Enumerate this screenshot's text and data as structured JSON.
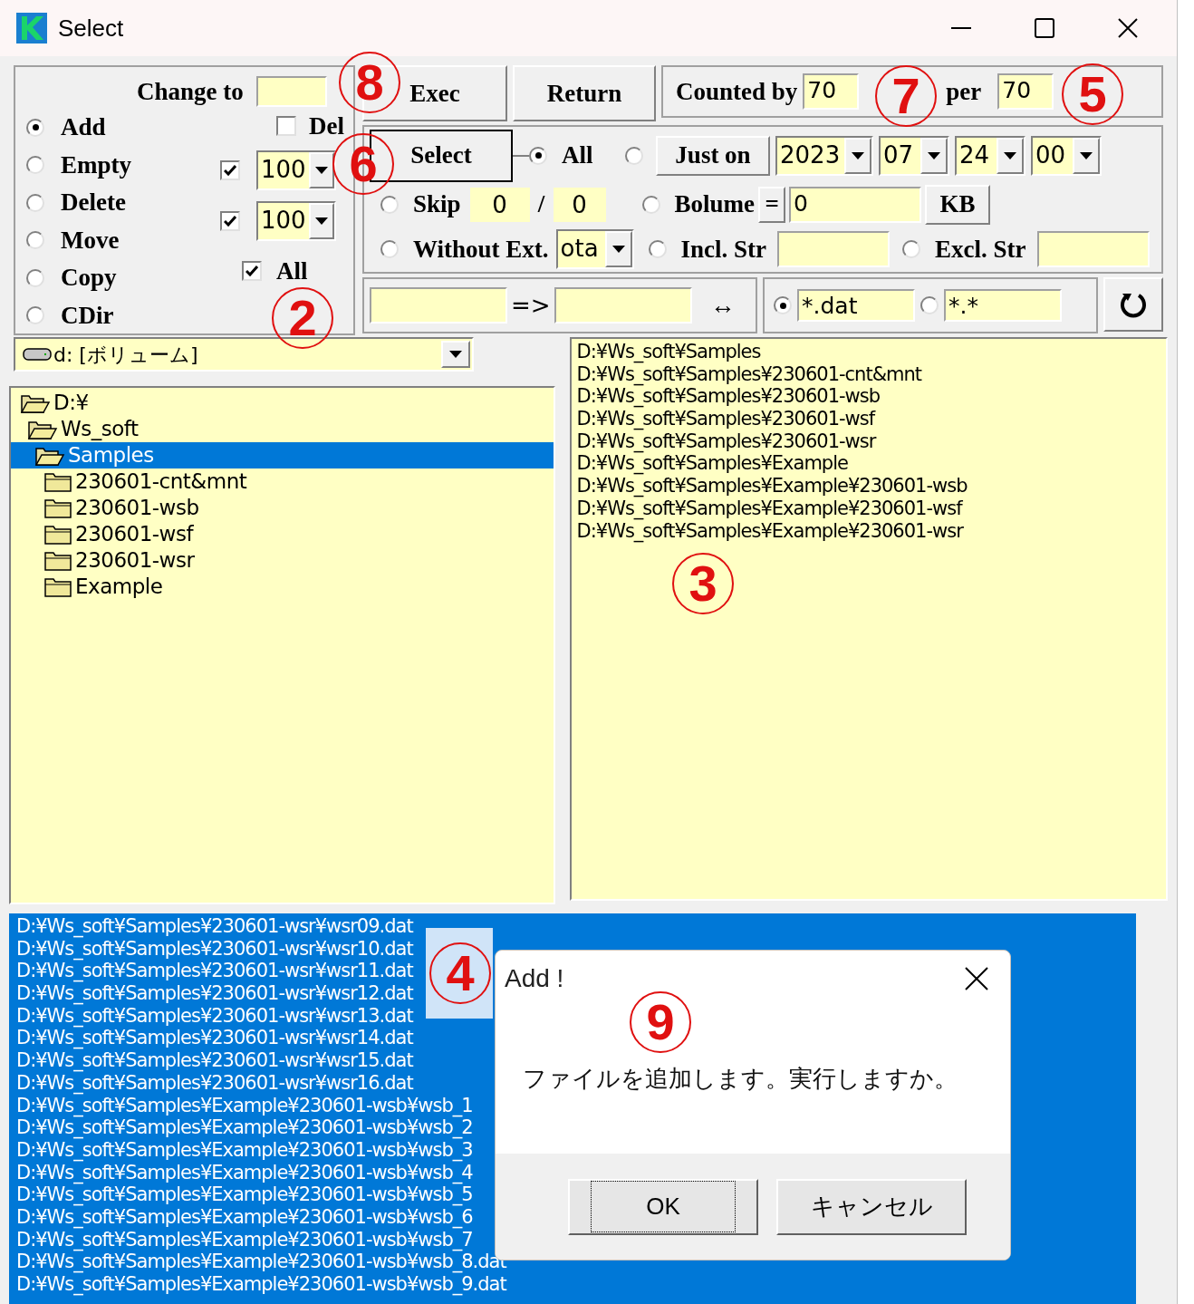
{
  "window": {
    "title": "Select"
  },
  "mode_panel": {
    "change_to_label": "Change to",
    "modes": [
      {
        "label": "Add",
        "selected": true
      },
      {
        "label": "Empty",
        "selected": false
      },
      {
        "label": "Delete",
        "selected": false
      },
      {
        "label": "Move",
        "selected": false
      },
      {
        "label": "Copy",
        "selected": false
      },
      {
        "label": "CDir",
        "selected": false
      }
    ],
    "del": {
      "label": "Del",
      "checked": false
    },
    "limits": [
      {
        "checked": true,
        "value": "100"
      },
      {
        "checked": true,
        "value": "100"
      }
    ],
    "all": {
      "label": "All",
      "checked": true
    }
  },
  "toolbar": {
    "buttons": [
      "Exec",
      "Return"
    ]
  },
  "counter": {
    "label": "Counted by",
    "value": "70",
    "per_label": "per",
    "per_value": "70"
  },
  "select_panel": {
    "button": "Select",
    "all": {
      "label": "All",
      "selected": true
    },
    "just_on": {
      "label": "Just on",
      "selected": false,
      "date": [
        "2023",
        "07",
        "24",
        "00"
      ]
    },
    "skip": {
      "label": "Skip",
      "selected": false,
      "from": "0",
      "separator": "/",
      "to": "0"
    },
    "volume": {
      "label": "Bolume",
      "selected": false,
      "operator": "=",
      "value": "0",
      "unit": "KB"
    },
    "without_ext": {
      "label": "Without Ext.",
      "selected": false,
      "value": "ota"
    },
    "incl_str": {
      "label": "Incl. Str",
      "selected": false
    },
    "excl_str": {
      "label": "Excl. Str",
      "selected": false
    }
  },
  "rename": {
    "arrow": "=>",
    "swap": "↔"
  },
  "filters": [
    {
      "value": "*.dat",
      "selected": true
    },
    {
      "value": "*.*",
      "selected": false
    }
  ],
  "drive": {
    "value": "d: [ボリューム]"
  },
  "folder_tree": [
    {
      "label": "D:¥",
      "expanded": true,
      "selected": false,
      "children": [
        {
          "label": "Ws_soft",
          "expanded": true,
          "selected": false,
          "children": [
            {
              "label": "Samples",
              "expanded": true,
              "selected": true,
              "children": [
                {
                  "label": "230601-cnt&mnt",
                  "expanded": false,
                  "selected": false
                },
                {
                  "label": "230601-wsb",
                  "expanded": false,
                  "selected": false
                },
                {
                  "label": "230601-wsf",
                  "expanded": false,
                  "selected": false
                },
                {
                  "label": "230601-wsr",
                  "expanded": false,
                  "selected": false
                },
                {
                  "label": "Example",
                  "expanded": false,
                  "selected": false
                }
              ]
            }
          ]
        }
      ]
    }
  ],
  "file_list": [
    "D:¥Ws_soft¥Samples",
    "D:¥Ws_soft¥Samples¥230601-cnt&mnt",
    "D:¥Ws_soft¥Samples¥230601-wsb",
    "D:¥Ws_soft¥Samples¥230601-wsf",
    "D:¥Ws_soft¥Samples¥230601-wsr",
    "D:¥Ws_soft¥Samples¥Example",
    "D:¥Ws_soft¥Samples¥Example¥230601-wsb",
    "D:¥Ws_soft¥Samples¥Example¥230601-wsf",
    "D:¥Ws_soft¥Samples¥Example¥230601-wsr"
  ],
  "result_list": [
    "D:¥Ws_soft¥Samples¥230601-wsr¥wsr09.dat",
    "D:¥Ws_soft¥Samples¥230601-wsr¥wsr10.dat",
    "D:¥Ws_soft¥Samples¥230601-wsr¥wsr11.dat",
    "D:¥Ws_soft¥Samples¥230601-wsr¥wsr12.dat",
    "D:¥Ws_soft¥Samples¥230601-wsr¥wsr13.dat",
    "D:¥Ws_soft¥Samples¥230601-wsr¥wsr14.dat",
    "D:¥Ws_soft¥Samples¥230601-wsr¥wsr15.dat",
    "D:¥Ws_soft¥Samples¥230601-wsr¥wsr16.dat",
    "D:¥Ws_soft¥Samples¥Example¥230601-wsb¥wsb_1",
    "D:¥Ws_soft¥Samples¥Example¥230601-wsb¥wsb_2",
    "D:¥Ws_soft¥Samples¥Example¥230601-wsb¥wsb_3",
    "D:¥Ws_soft¥Samples¥Example¥230601-wsb¥wsb_4",
    "D:¥Ws_soft¥Samples¥Example¥230601-wsb¥wsb_5",
    "D:¥Ws_soft¥Samples¥Example¥230601-wsb¥wsb_6",
    "D:¥Ws_soft¥Samples¥Example¥230601-wsb¥wsb_7",
    "D:¥Ws_soft¥Samples¥Example¥230601-wsb¥wsb_8.dat",
    "D:¥Ws_soft¥Samples¥Example¥230601-wsb¥wsb_9.dat"
  ],
  "dialog": {
    "title": "Add !",
    "message": "ファイルを追加します。実行しますか。",
    "buttons": [
      {
        "label": "OK",
        "focused": true
      },
      {
        "label": "キャンセル",
        "focused": false
      }
    ]
  },
  "annotations": [
    {
      "label": "8"
    },
    {
      "label": "7"
    },
    {
      "label": "5"
    },
    {
      "label": "6"
    },
    {
      "label": "2"
    },
    {
      "label": "3"
    },
    {
      "label": "4"
    },
    {
      "label": "9"
    }
  ]
}
